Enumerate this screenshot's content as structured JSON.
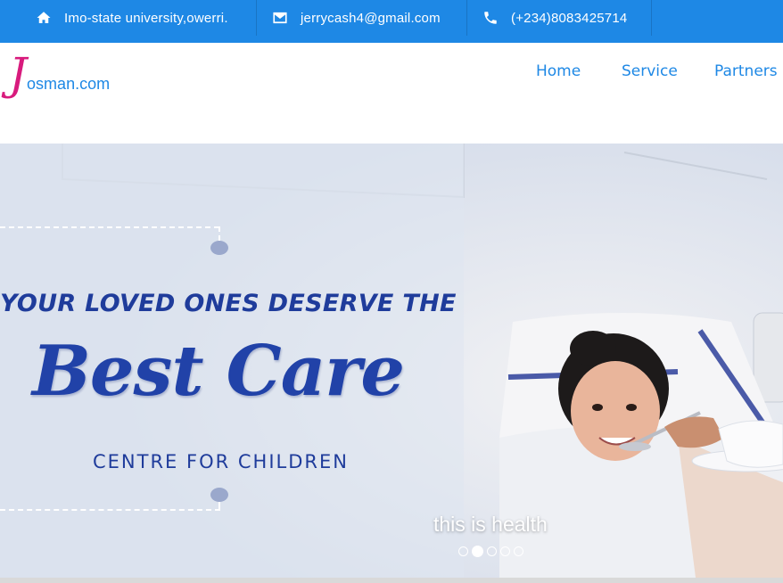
{
  "topbar": {
    "address": "Imo-state university,owerri.",
    "email": "jerrycash4@gmail.com",
    "phone": "(+234)8083425714",
    "icons": [
      "home-icon",
      "mail-icon",
      "phone-icon"
    ]
  },
  "logo": {
    "initial": "J",
    "rest": "osman.com"
  },
  "nav": {
    "items": [
      {
        "label": "Home"
      },
      {
        "label": "Service"
      },
      {
        "label": "Partners"
      }
    ]
  },
  "hero": {
    "tagline": "YOUR LOVED ONES DESERVE THE",
    "headline": "Best Care",
    "subheadline": "CENTRE FOR CHILDREN",
    "caption": "this is health",
    "slide_count": 5,
    "active_slide": 2
  },
  "colors": {
    "topbar": "#1e88e5",
    "logo_initial": "#d81b7d",
    "brand_blue": "#1e88e5",
    "hero_text": "#1f3c9b"
  }
}
